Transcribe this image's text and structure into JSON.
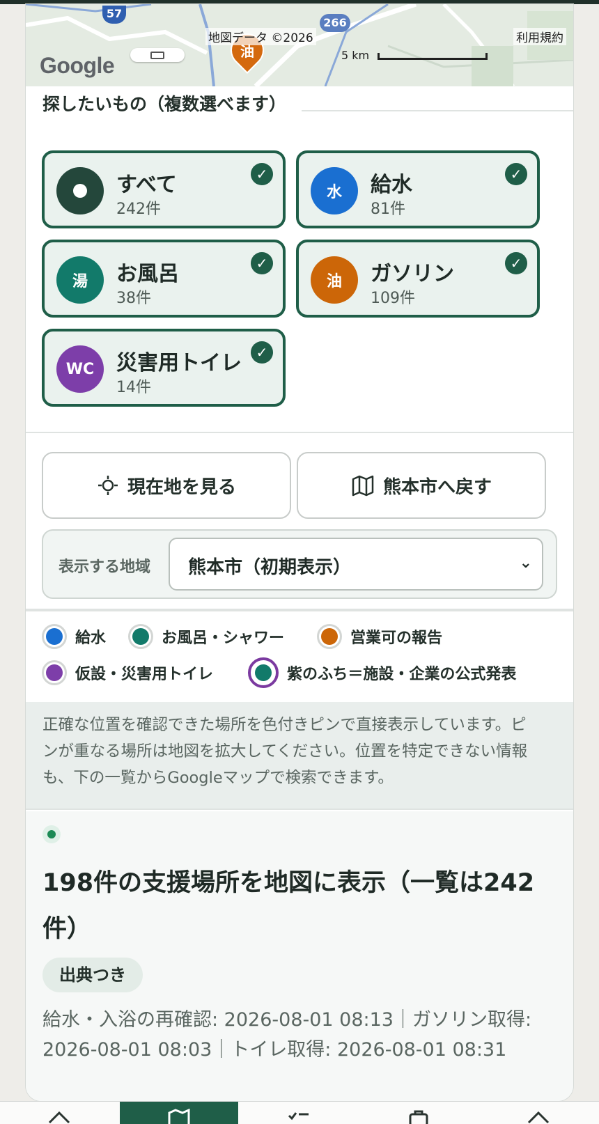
{
  "map": {
    "attribution": "地図データ ©2026",
    "terms_link": "利用規約",
    "scale_label": "5 km",
    "logo": "Google",
    "road_badges": [
      "57",
      "266"
    ],
    "pin_label": "油"
  },
  "filters": {
    "title": "探したいもの（複数選べます）",
    "items": [
      {
        "name": "すべて",
        "count": "242件",
        "icon_text": "",
        "color": "#24473b",
        "checked": true
      },
      {
        "name": "給水",
        "count": "81件",
        "icon_text": "水",
        "color": "#1a6fd1",
        "checked": true
      },
      {
        "name": "お風呂",
        "count": "38件",
        "icon_text": "湯",
        "color": "#127a6a",
        "checked": true
      },
      {
        "name": "ガソリン",
        "count": "109件",
        "icon_text": "油",
        "color": "#cc6608",
        "checked": true
      },
      {
        "name": "災害用トイレ",
        "count": "14件",
        "icon_text": "WC",
        "color": "#7d3ea9",
        "checked": true
      }
    ]
  },
  "actions": {
    "locate_label": "現在地を見る",
    "reset_label": "熊本市へ戻す"
  },
  "region": {
    "label": "表示する地域",
    "selected": "熊本市（初期表示）"
  },
  "legend": {
    "items": [
      {
        "label": "給水",
        "color": "#1a6fd1"
      },
      {
        "label": "お風呂・シャワー",
        "color": "#127a6a"
      },
      {
        "label": "営業可の報告",
        "color": "#cc6608"
      },
      {
        "label": "仮設・災害用トイレ",
        "color": "#7d3ea9"
      },
      {
        "label": "紫のふち＝施設・企業の公式発表",
        "color": "#127a6a",
        "ring_color": "#7b3aa0"
      }
    ]
  },
  "note": "正確な位置を確認できた場所を色付きピンで直接表示しています。ピンが重なる場所は地図を拡大してください。位置を特定できない情報も、下の一覧からGoogleマップで検索できます。",
  "summary": {
    "heading": "198件の支援場所を地図に表示（一覧は242件）",
    "badge": "出典つき",
    "timestamps": "給水・入浴の再確認: 2026-08-01 08:13｜ガソリン取得: 2026-08-01 08:03｜トイレ取得: 2026-08-01 08:31"
  },
  "bottom_nav": {
    "items": [
      "home-icon",
      "map-icon",
      "checklist-icon",
      "bag-icon",
      "up-icon"
    ],
    "active_index": 1
  }
}
